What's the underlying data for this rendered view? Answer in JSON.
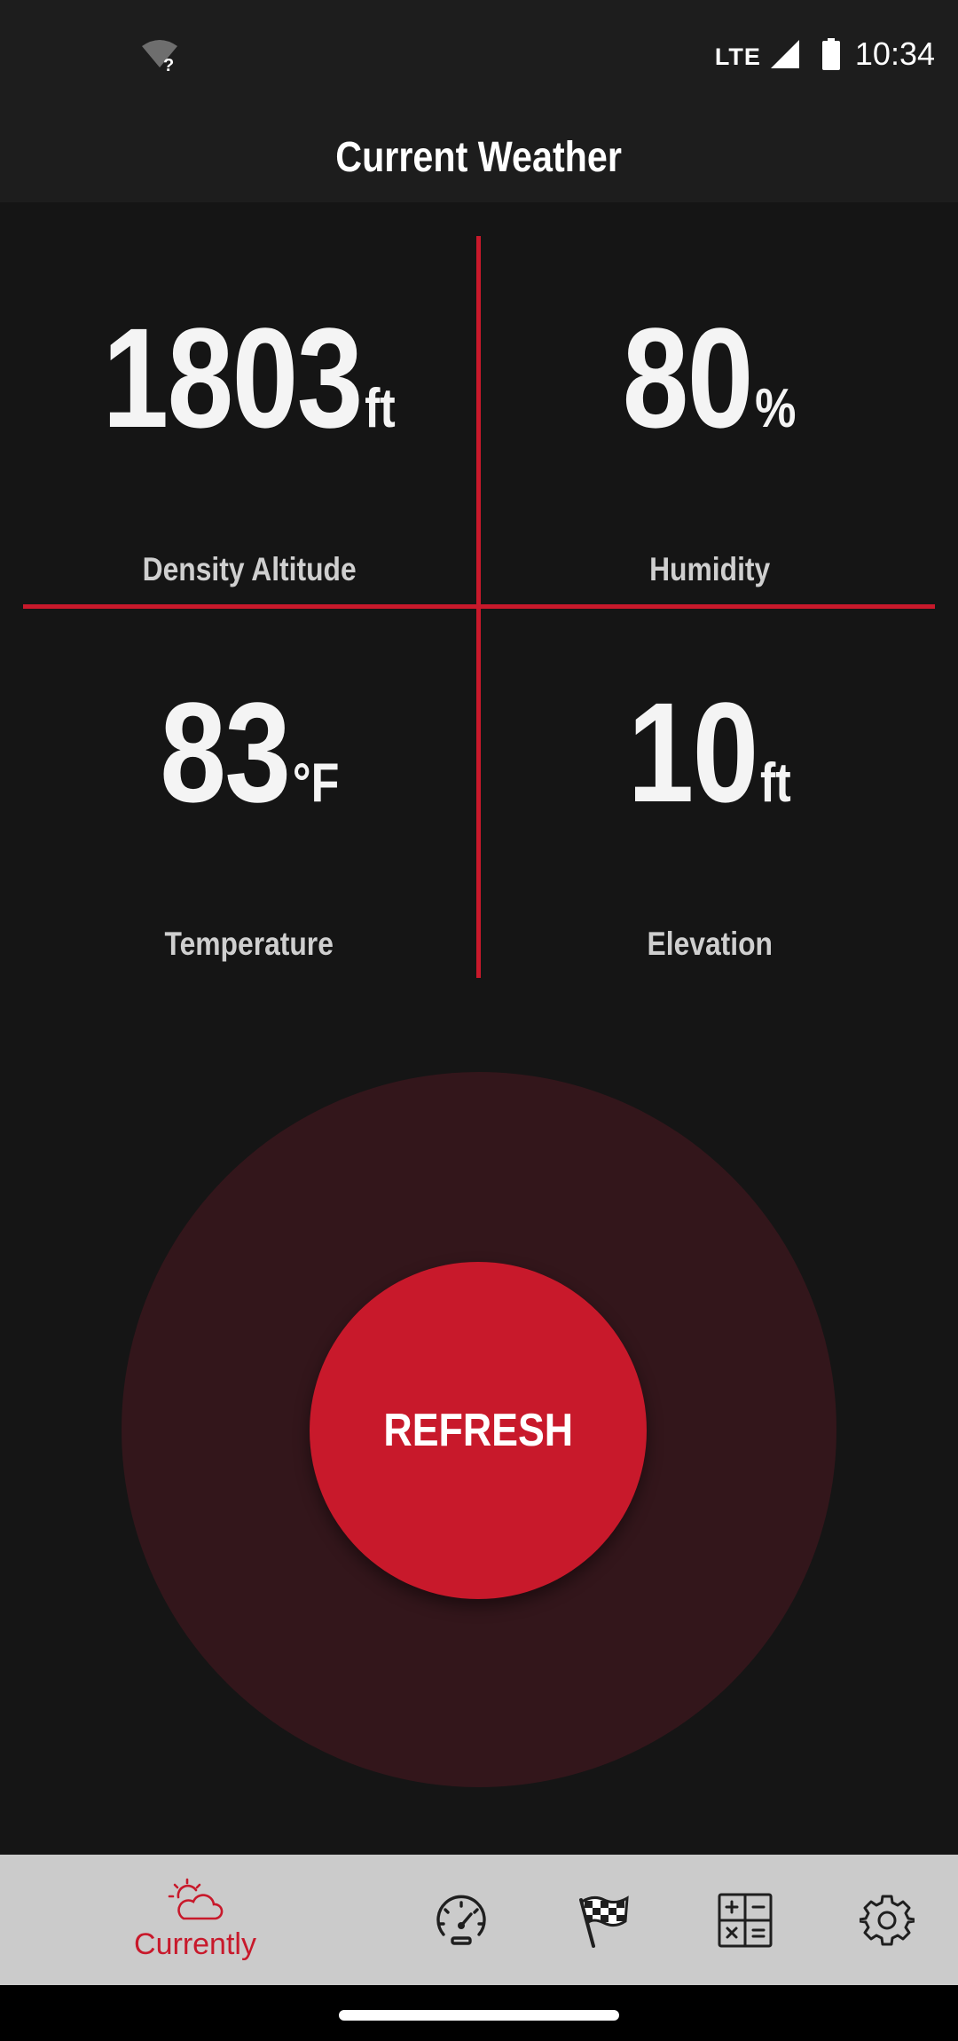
{
  "status_bar": {
    "network": "LTE",
    "time": "10:34",
    "wifi_icon": "wifi-unknown-icon",
    "signal_icon": "cell-signal-icon",
    "battery_icon": "battery-icon"
  },
  "header": {
    "title": "Current Weather"
  },
  "metrics": [
    {
      "value": "1803",
      "unit": "ft",
      "label": "Density Altitude"
    },
    {
      "value": "80",
      "unit": "%",
      "label": "Humidity"
    },
    {
      "value": "83",
      "unit": "°F",
      "label": "Temperature"
    },
    {
      "value": "10",
      "unit": "ft",
      "label": "Elevation"
    }
  ],
  "refresh": {
    "label": "REFRESH"
  },
  "bottom_nav": {
    "items": [
      {
        "label": "Currently",
        "icon": "partly-sunny-icon",
        "active": true
      },
      {
        "label": "",
        "icon": "speedometer-icon",
        "active": false
      },
      {
        "label": "",
        "icon": "checkered-flag-icon",
        "active": false
      },
      {
        "label": "",
        "icon": "calculator-icon",
        "active": false
      },
      {
        "label": "",
        "icon": "gear-icon",
        "active": false
      }
    ]
  },
  "colors": {
    "accent": "#c8192b",
    "background": "#151515",
    "header": "#1d1d1d",
    "refresh_ring": "#33161b",
    "nav_background": "#cbcbcb"
  }
}
